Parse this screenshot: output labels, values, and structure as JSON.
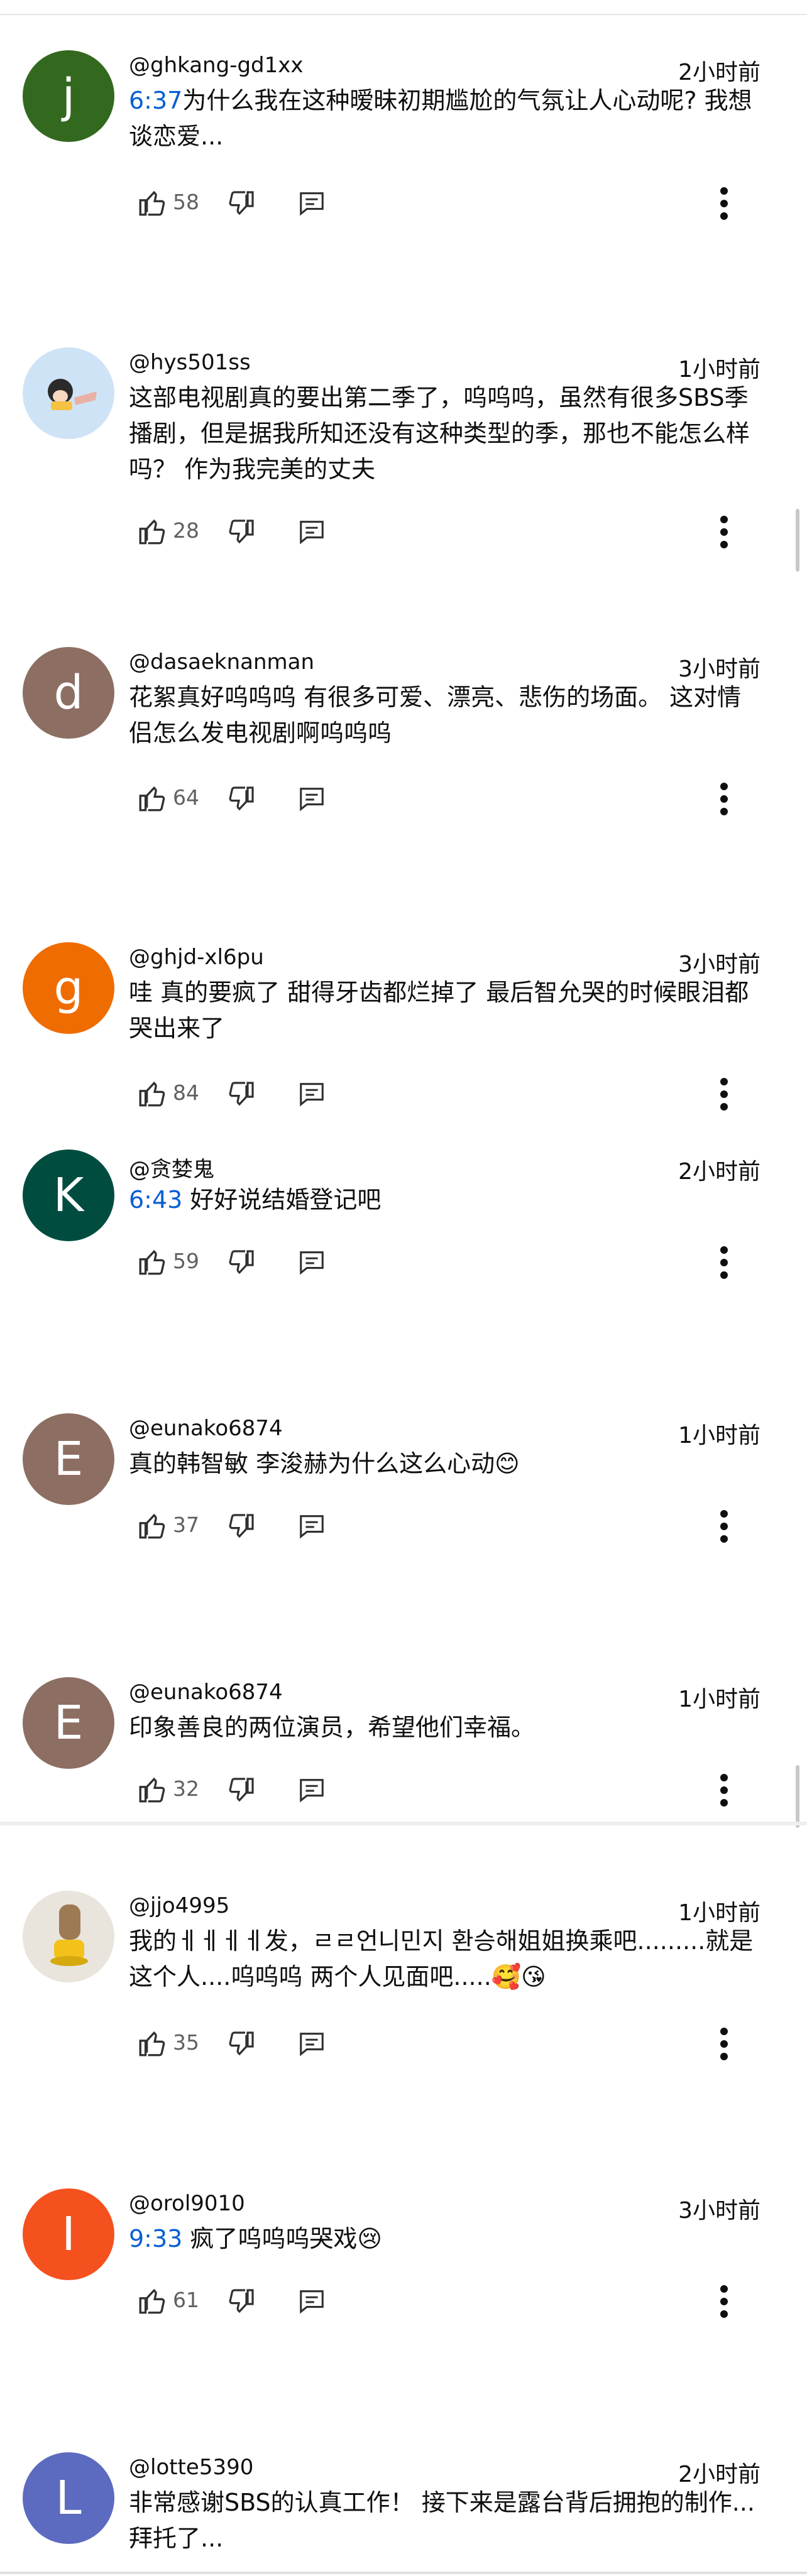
{
  "comments": [
    {
      "avatar_letter": "j",
      "avatar_color": "#33691e",
      "handle": "@ghkang-gd1xx",
      "time": "2小时前",
      "timestamp": "6:37",
      "text": "为什么我在这种暧昧初期尴尬的气氛让人心动呢? 我想谈恋爱...",
      "likes": "58"
    },
    {
      "avatar_letter": "",
      "avatar_color": "#cfe3f7",
      "handle": "@hys501ss",
      "time": "1小时前",
      "timestamp": "",
      "text": "这部电视剧真的要出第二季了，呜呜呜，虽然有很多SBS季播剧，但是据我所知还没有这种类型的季，那也不能怎么样吗？ 作为我完美的丈夫",
      "likes": "28"
    },
    {
      "avatar_letter": "d",
      "avatar_color": "#8d6e63",
      "handle": "@dasaeknanman",
      "time": "3小时前",
      "timestamp": "",
      "text": "花絮真好呜呜呜 有很多可爱、漂亮、悲伤的场面。 这对情侣怎么发电视剧啊呜呜呜",
      "likes": "64"
    },
    {
      "avatar_letter": "g",
      "avatar_color": "#ef6c00",
      "handle": "@ghjd-xl6pu",
      "time": "3小时前",
      "timestamp": "",
      "text": "哇 真的要疯了 甜得牙齿都烂掉了 最后智允哭的时候眼泪都哭出来了",
      "likes": "84"
    },
    {
      "avatar_letter": "K",
      "avatar_color": "#004d40",
      "handle": "@贪婪鬼",
      "time": "2小时前",
      "timestamp": "6:43",
      "text": " 好好说结婚登记吧",
      "likes": "59"
    },
    {
      "avatar_letter": "E",
      "avatar_color": "#8d6e63",
      "handle": "@eunako6874",
      "time": "1小时前",
      "timestamp": "",
      "text": "真的韩智敏 李浚赫为什么这么心动😊",
      "likes": "37"
    },
    {
      "avatar_letter": "E",
      "avatar_color": "#8d6e63",
      "handle": "@eunako6874",
      "time": "1小时前",
      "timestamp": "",
      "text": "印象善良的两位演员，希望他们幸福。",
      "likes": "32"
    },
    {
      "avatar_letter": "",
      "avatar_color": "#e9e4dc",
      "handle": "@jjo4995",
      "time": "1小时前",
      "timestamp": "",
      "text": "我的ㅔㅔㅔㅔ发，ㄹㄹ언니민지 환승해姐姐换乘吧.........就是这个人....呜呜呜 两个人见面吧.....🥰😘",
      "likes": "35"
    },
    {
      "avatar_letter": "I",
      "avatar_color": "#f4511e",
      "handle": "@orol9010",
      "time": "3小时前",
      "timestamp": "9:33",
      "text": " 疯了呜呜呜哭戏😢",
      "likes": "61"
    },
    {
      "avatar_letter": "L",
      "avatar_color": "#5c6bc0",
      "handle": "@lotte5390",
      "time": "2小时前",
      "timestamp": "",
      "text": "非常感谢SBS的认真工作！ 接下来是露台背后拥抱的制作...拜托了...",
      "likes": ""
    }
  ]
}
